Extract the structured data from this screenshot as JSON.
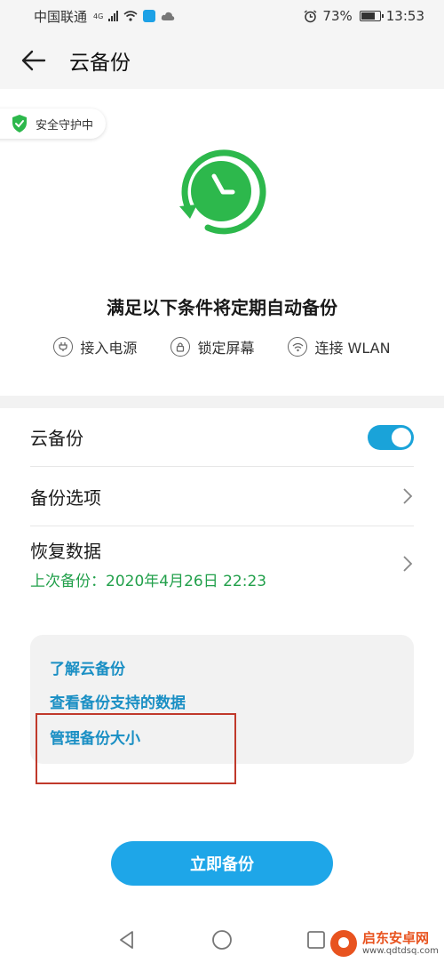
{
  "status_bar": {
    "carrier": "中国联通",
    "network": "4G",
    "battery": "73%",
    "time": "13:53"
  },
  "header": {
    "title": "云备份"
  },
  "hero": {
    "security_badge": "安全守护中",
    "condition_title": "满足以下条件将定期自动备份",
    "conditions": [
      {
        "label": "接入电源",
        "icon": "plug-icon"
      },
      {
        "label": "锁定屏幕",
        "icon": "lock-icon"
      },
      {
        "label": "连接 WLAN",
        "icon": "wifi-icon"
      }
    ]
  },
  "settings": {
    "cloud_backup": {
      "label": "云备份",
      "enabled": true
    },
    "backup_options": {
      "label": "备份选项"
    },
    "restore": {
      "label": "恢复数据",
      "last_backup": "上次备份：2020年4月26日 22:23"
    }
  },
  "info_card": {
    "links": [
      "了解云备份",
      "查看备份支持的数据",
      "管理备份大小"
    ]
  },
  "backup_now_label": "立即备份",
  "watermark": {
    "name": "启东安卓网",
    "url": "www.qdtdsq.com"
  },
  "colors": {
    "accent": "#1ea6e8",
    "success": "#22a04b",
    "clock_green": "#2db84c",
    "highlight": "#c0392b"
  }
}
